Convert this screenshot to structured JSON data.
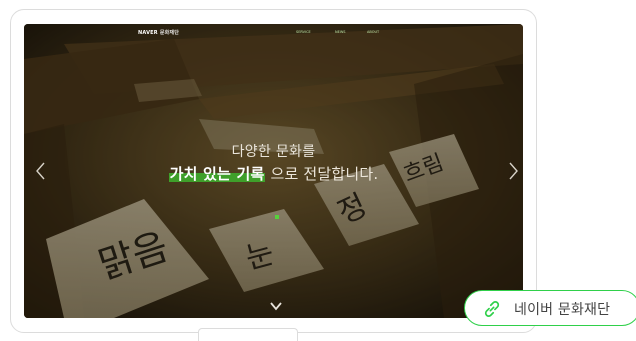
{
  "header": {
    "logo_naver": "NAVER",
    "logo_foundation": "문화재단",
    "nav": [
      "SERVICE",
      "NEWS",
      "ABOUT"
    ]
  },
  "hero": {
    "line1": "다양한 문화를",
    "highlight": "가치 있는 기록",
    "line2_rest": "으로 전달합니다.",
    "tile_texts": [
      "맑음",
      "눈",
      "정",
      "흐림"
    ]
  },
  "carousel": {
    "prev_icon": "chevron-left-icon",
    "next_icon": "chevron-right-icon",
    "scroll_icon": "chevron-down-icon"
  },
  "badge": {
    "label": "네이버 문화재단",
    "icon": "link-icon"
  },
  "colors": {
    "accent_green": "#3f9f2a",
    "badge_border": "#2fd04a",
    "indicator": "#56d23b"
  }
}
